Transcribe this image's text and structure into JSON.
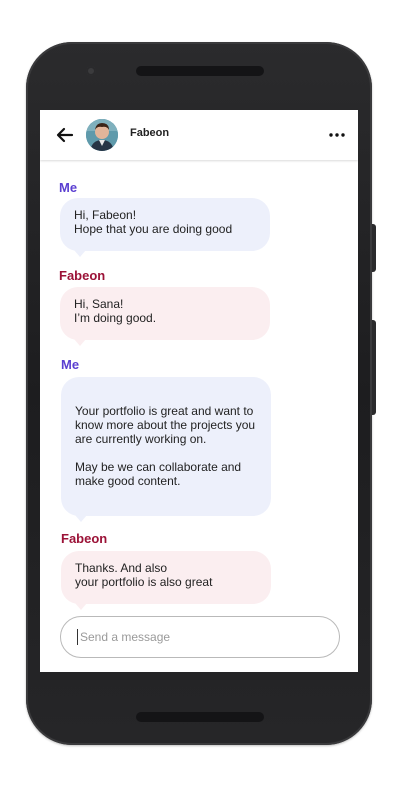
{
  "header": {
    "contact_name": "Fabeon",
    "back_icon": "arrow-left-icon",
    "more_icon": "more-horizontal-icon"
  },
  "messages": [
    {
      "sender": "Me",
      "lines": [
        "Hi, Fabeon!",
        "Hope that you are doing good"
      ]
    },
    {
      "sender": "Fabeon",
      "lines": [
        "Hi, Sana!",
        "I’m doing good."
      ]
    },
    {
      "sender": "Me",
      "lines": [
        "Your portfolio is great and want to",
        "know more about the projects you",
        "are currently working on.",
        "",
        "May be we can collaborate and",
        "make good content."
      ]
    },
    {
      "sender": "Fabeon",
      "lines": [
        "Thanks. And also",
        "your portfolio is also great"
      ]
    }
  ],
  "composer": {
    "placeholder": "Send a message",
    "value": ""
  },
  "colors": {
    "me_name": "#5b3fd1",
    "other_name": "#9b1237",
    "me_bubble": "#edf0fb",
    "other_bubble": "#fbeef0"
  }
}
